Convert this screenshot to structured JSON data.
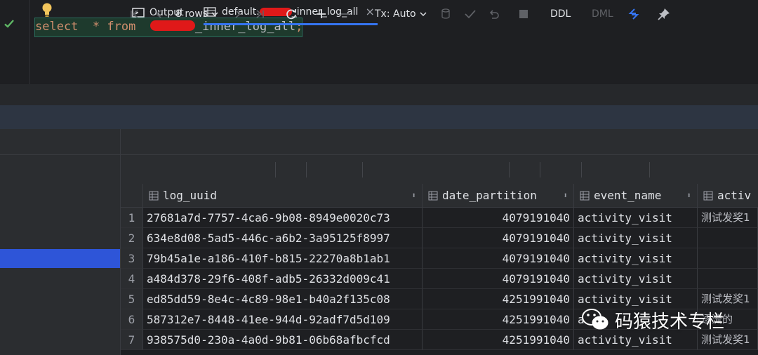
{
  "editor": {
    "code_keyword_select": "select",
    "code_star": "*",
    "code_keyword_from": "from",
    "code_table_suffix": "_inner_log_all",
    "code_semicolon": ";"
  },
  "tabs": {
    "output_label": "Output",
    "table_prefix": "default.",
    "table_suffix": "_inner_log_all",
    "close_glyph": "×"
  },
  "toolbar": {
    "rows_label": "8 rows",
    "tx_label": "Tx: Auto",
    "ddl_label": "DDL",
    "dml_label": "DML"
  },
  "grid": {
    "columns": [
      "log_uuid",
      "date_partition",
      "event_name",
      "activ"
    ],
    "rows": [
      {
        "n": "1",
        "log_uuid": "27681a7d-7757-4ca6-9b08-8949e0020c73",
        "date_partition": "4079191040",
        "event_name": "activity_visit",
        "activ": "测试发奖1"
      },
      {
        "n": "2",
        "log_uuid": "634e8d08-5ad5-446c-a6b2-3a95125f8997",
        "date_partition": "4079191040",
        "event_name": "activity_visit",
        "activ": ""
      },
      {
        "n": "3",
        "log_uuid": "79b45a1e-a186-410f-b815-22270a8b1ab1",
        "date_partition": "4079191040",
        "event_name": "activity_visit",
        "activ": ""
      },
      {
        "n": "4",
        "log_uuid": "a484d378-29f6-408f-adb5-26332d009c41",
        "date_partition": "4079191040",
        "event_name": "activity_visit",
        "activ": ""
      },
      {
        "n": "5",
        "log_uuid": "ed85dd59-8e4c-4c89-98e1-b40a2f135c08",
        "date_partition": "4251991040",
        "event_name": "activity_visit",
        "activ": "测试发奖1"
      },
      {
        "n": "6",
        "log_uuid": "587312e7-8448-41ee-944d-92adf7d5d109",
        "date_partition": "4251991040",
        "event_name": "a",
        "activ": "逐流的"
      },
      {
        "n": "7",
        "log_uuid": "938575d0-230a-4a0d-9b81-06b68afbcfcd",
        "date_partition": "4251991040",
        "event_name": "activity_visit",
        "activ": "测试发奖1"
      }
    ]
  },
  "watermark": {
    "text": "码猿技术专栏"
  },
  "colors": {
    "keyword": "#cf8e6d",
    "selection": "#2e55d8",
    "accent": "#3574f0",
    "redaction": "#e01919"
  }
}
